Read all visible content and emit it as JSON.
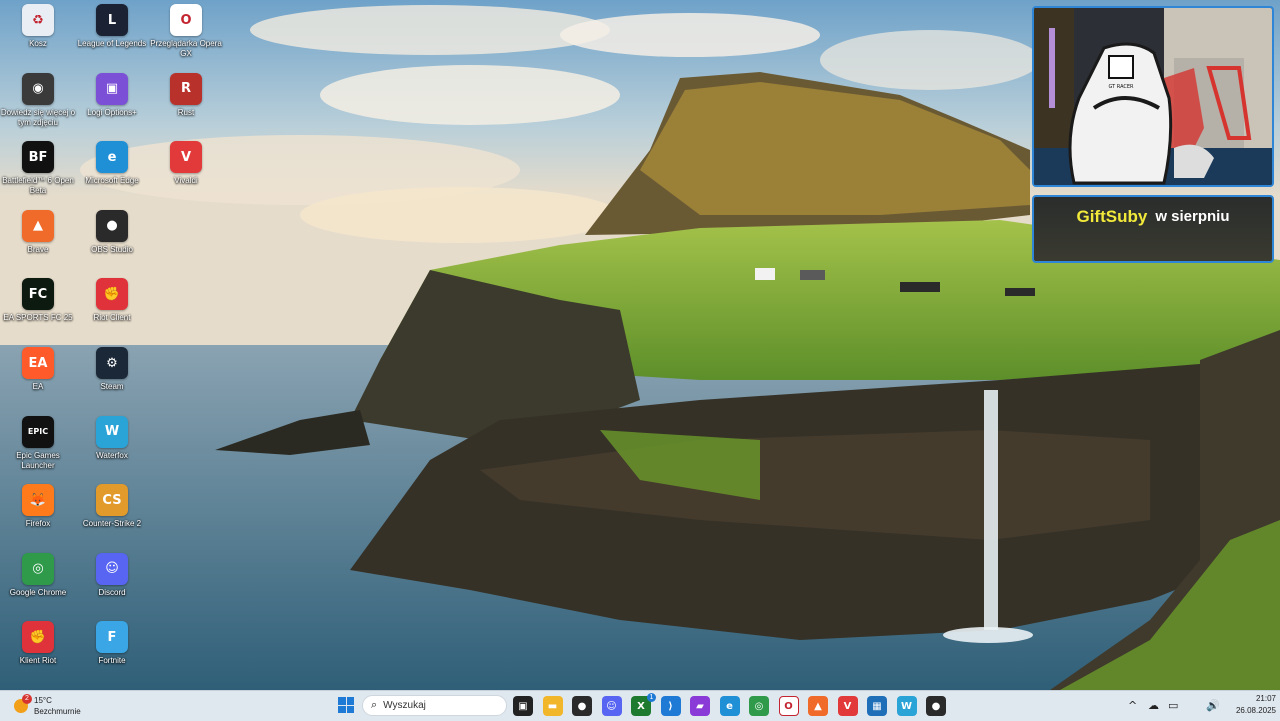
{
  "desktop": {
    "icons": [
      {
        "label": "Kosz",
        "icon": "recycle-bin-icon",
        "color": "#e8eef4"
      },
      {
        "label": "League of Legends",
        "icon": "league-icon",
        "color": "#1a2233"
      },
      {
        "label": "Przeglądarka Opera GX",
        "icon": "opera-gx-icon",
        "color": "#ffffff"
      },
      {
        "label": "Dowiedz się więcej o tym zdjęciu",
        "icon": "info-camera-icon",
        "color": "#3a3a3a"
      },
      {
        "label": "Logi Options+",
        "icon": "logi-icon",
        "color": "#7b4fd6"
      },
      {
        "label": "Rust",
        "icon": "rust-icon",
        "color": "#b8312b"
      },
      {
        "label": "Battlefield™ 6 Open Beta",
        "icon": "battlefield-icon",
        "color": "#111111"
      },
      {
        "label": "Microsoft Edge",
        "icon": "edge-icon",
        "color": "#1f8fd6"
      },
      {
        "label": "Vivaldi",
        "icon": "vivaldi-icon",
        "color": "#e23a3a"
      },
      {
        "label": "Brave",
        "icon": "brave-icon",
        "color": "#f06a2a"
      },
      {
        "label": "OBS Studio",
        "icon": "obs-icon",
        "color": "#2a2a2a"
      },
      {
        "label": "EA SPORTS FC 25",
        "icon": "fc25-icon",
        "color": "#0d1a10"
      },
      {
        "label": "Riot Client",
        "icon": "riot-client-icon",
        "color": "#e0323a"
      },
      {
        "label": "EA",
        "icon": "ea-icon",
        "color": "#ff5a2a"
      },
      {
        "label": "Steam",
        "icon": "steam-icon",
        "color": "#1b2838"
      },
      {
        "label": "Epic Games Launcher",
        "icon": "epic-icon",
        "color": "#111111"
      },
      {
        "label": "Waterfox",
        "icon": "waterfox-icon",
        "color": "#2aa3d6"
      },
      {
        "label": "Firefox",
        "icon": "firefox-icon",
        "color": "#ff7a1a"
      },
      {
        "label": "Counter-Strike 2",
        "icon": "cs2-icon",
        "color": "#e29a2a"
      },
      {
        "label": "Google Chrome",
        "icon": "chrome-icon",
        "color": "#2e9a4a"
      },
      {
        "label": "Discord",
        "icon": "discord-icon",
        "color": "#5865f2"
      },
      {
        "label": "Klient Riot",
        "icon": "riot-icon",
        "color": "#e0323a"
      },
      {
        "label": "Fortnite",
        "icon": "fortnite-icon",
        "color": "#3aa6e6"
      }
    ],
    "icon_glyphs": [
      "♻",
      "L",
      "O",
      "◉",
      "▣",
      "R",
      "BF",
      "e",
      "V",
      "▲",
      "●",
      "FC",
      "✊",
      "EA",
      "⚙",
      "EPIC",
      "W",
      "🦊",
      "CS",
      "◎",
      "☺",
      "✊",
      "F"
    ]
  },
  "overlay": {
    "gift_highlight": "GiftSuby",
    "gift_rest": "w sierpniu",
    "chair_brand": "GT RACER"
  },
  "taskbar": {
    "weather_temp": "15°C",
    "weather_desc": "Bezchmurnie",
    "weather_badge": "2",
    "search_placeholder": "Wyszukaj",
    "xbox_badge": "1",
    "time": "21:07",
    "date": "26.08.2025",
    "pinned": [
      {
        "icon": "task-view-icon",
        "color": "#222222",
        "glyph": "▣"
      },
      {
        "icon": "file-explorer-icon",
        "color": "#f2b62a",
        "glyph": "▬"
      },
      {
        "icon": "obs-icon",
        "color": "#2a2a2a",
        "glyph": "●"
      },
      {
        "icon": "discord-icon",
        "color": "#5865f2",
        "glyph": "☺"
      },
      {
        "icon": "xbox-icon",
        "color": "#1e7a2e",
        "glyph": "X"
      },
      {
        "icon": "vscode-icon",
        "color": "#1f7ad6",
        "glyph": "⟩"
      },
      {
        "icon": "app-purple-icon",
        "color": "#8a3ad6",
        "glyph": "▰"
      },
      {
        "icon": "edge-icon",
        "color": "#1f8fd6",
        "glyph": "e"
      },
      {
        "icon": "chrome-icon",
        "color": "#2e9a4a",
        "glyph": "◎"
      },
      {
        "icon": "opera-gx-icon",
        "color": "#ffffff",
        "glyph": "O"
      },
      {
        "icon": "brave-icon",
        "color": "#f06a2a",
        "glyph": "▲"
      },
      {
        "icon": "vivaldi-icon",
        "color": "#e23a3a",
        "glyph": "V"
      },
      {
        "icon": "photos-icon",
        "color": "#1f6fb8",
        "glyph": "▦"
      },
      {
        "icon": "waterfox-icon",
        "color": "#2aa3d6",
        "glyph": "W"
      },
      {
        "icon": "obs-record-icon",
        "color": "#2a2a2a",
        "glyph": "●"
      }
    ]
  }
}
